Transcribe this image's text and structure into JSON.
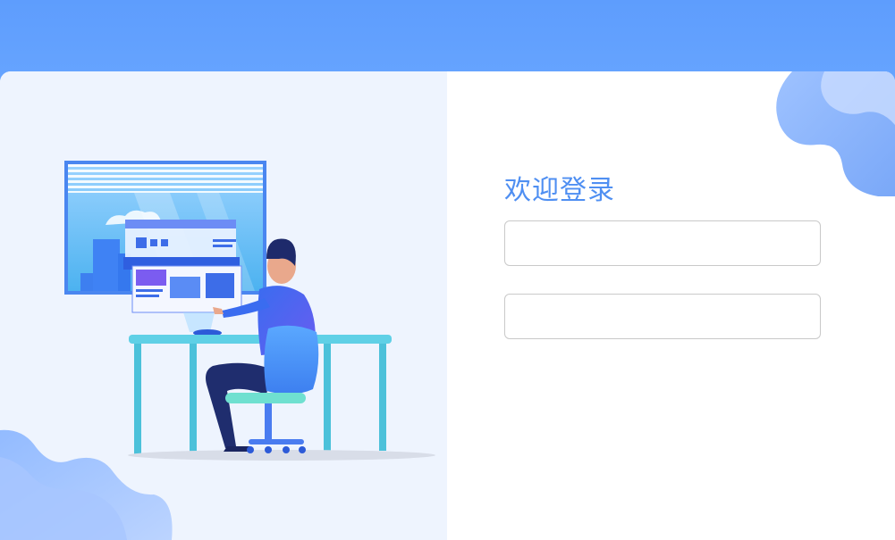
{
  "login": {
    "title": "欢迎登录",
    "username": {
      "value": "",
      "placeholder": ""
    },
    "password": {
      "value": "",
      "placeholder": ""
    }
  },
  "colors": {
    "brand_blue": "#5f9fff",
    "title_blue": "#4f8ff2",
    "left_panel_bg": "#eef4fe",
    "input_border": "#c9c9c9"
  },
  "illustration": {
    "subject": "person-at-desk-with-holographic-screen-icon",
    "decorations": [
      "cloud-blob-bottom-left-icon",
      "cloud-blob-top-right-icon"
    ]
  }
}
